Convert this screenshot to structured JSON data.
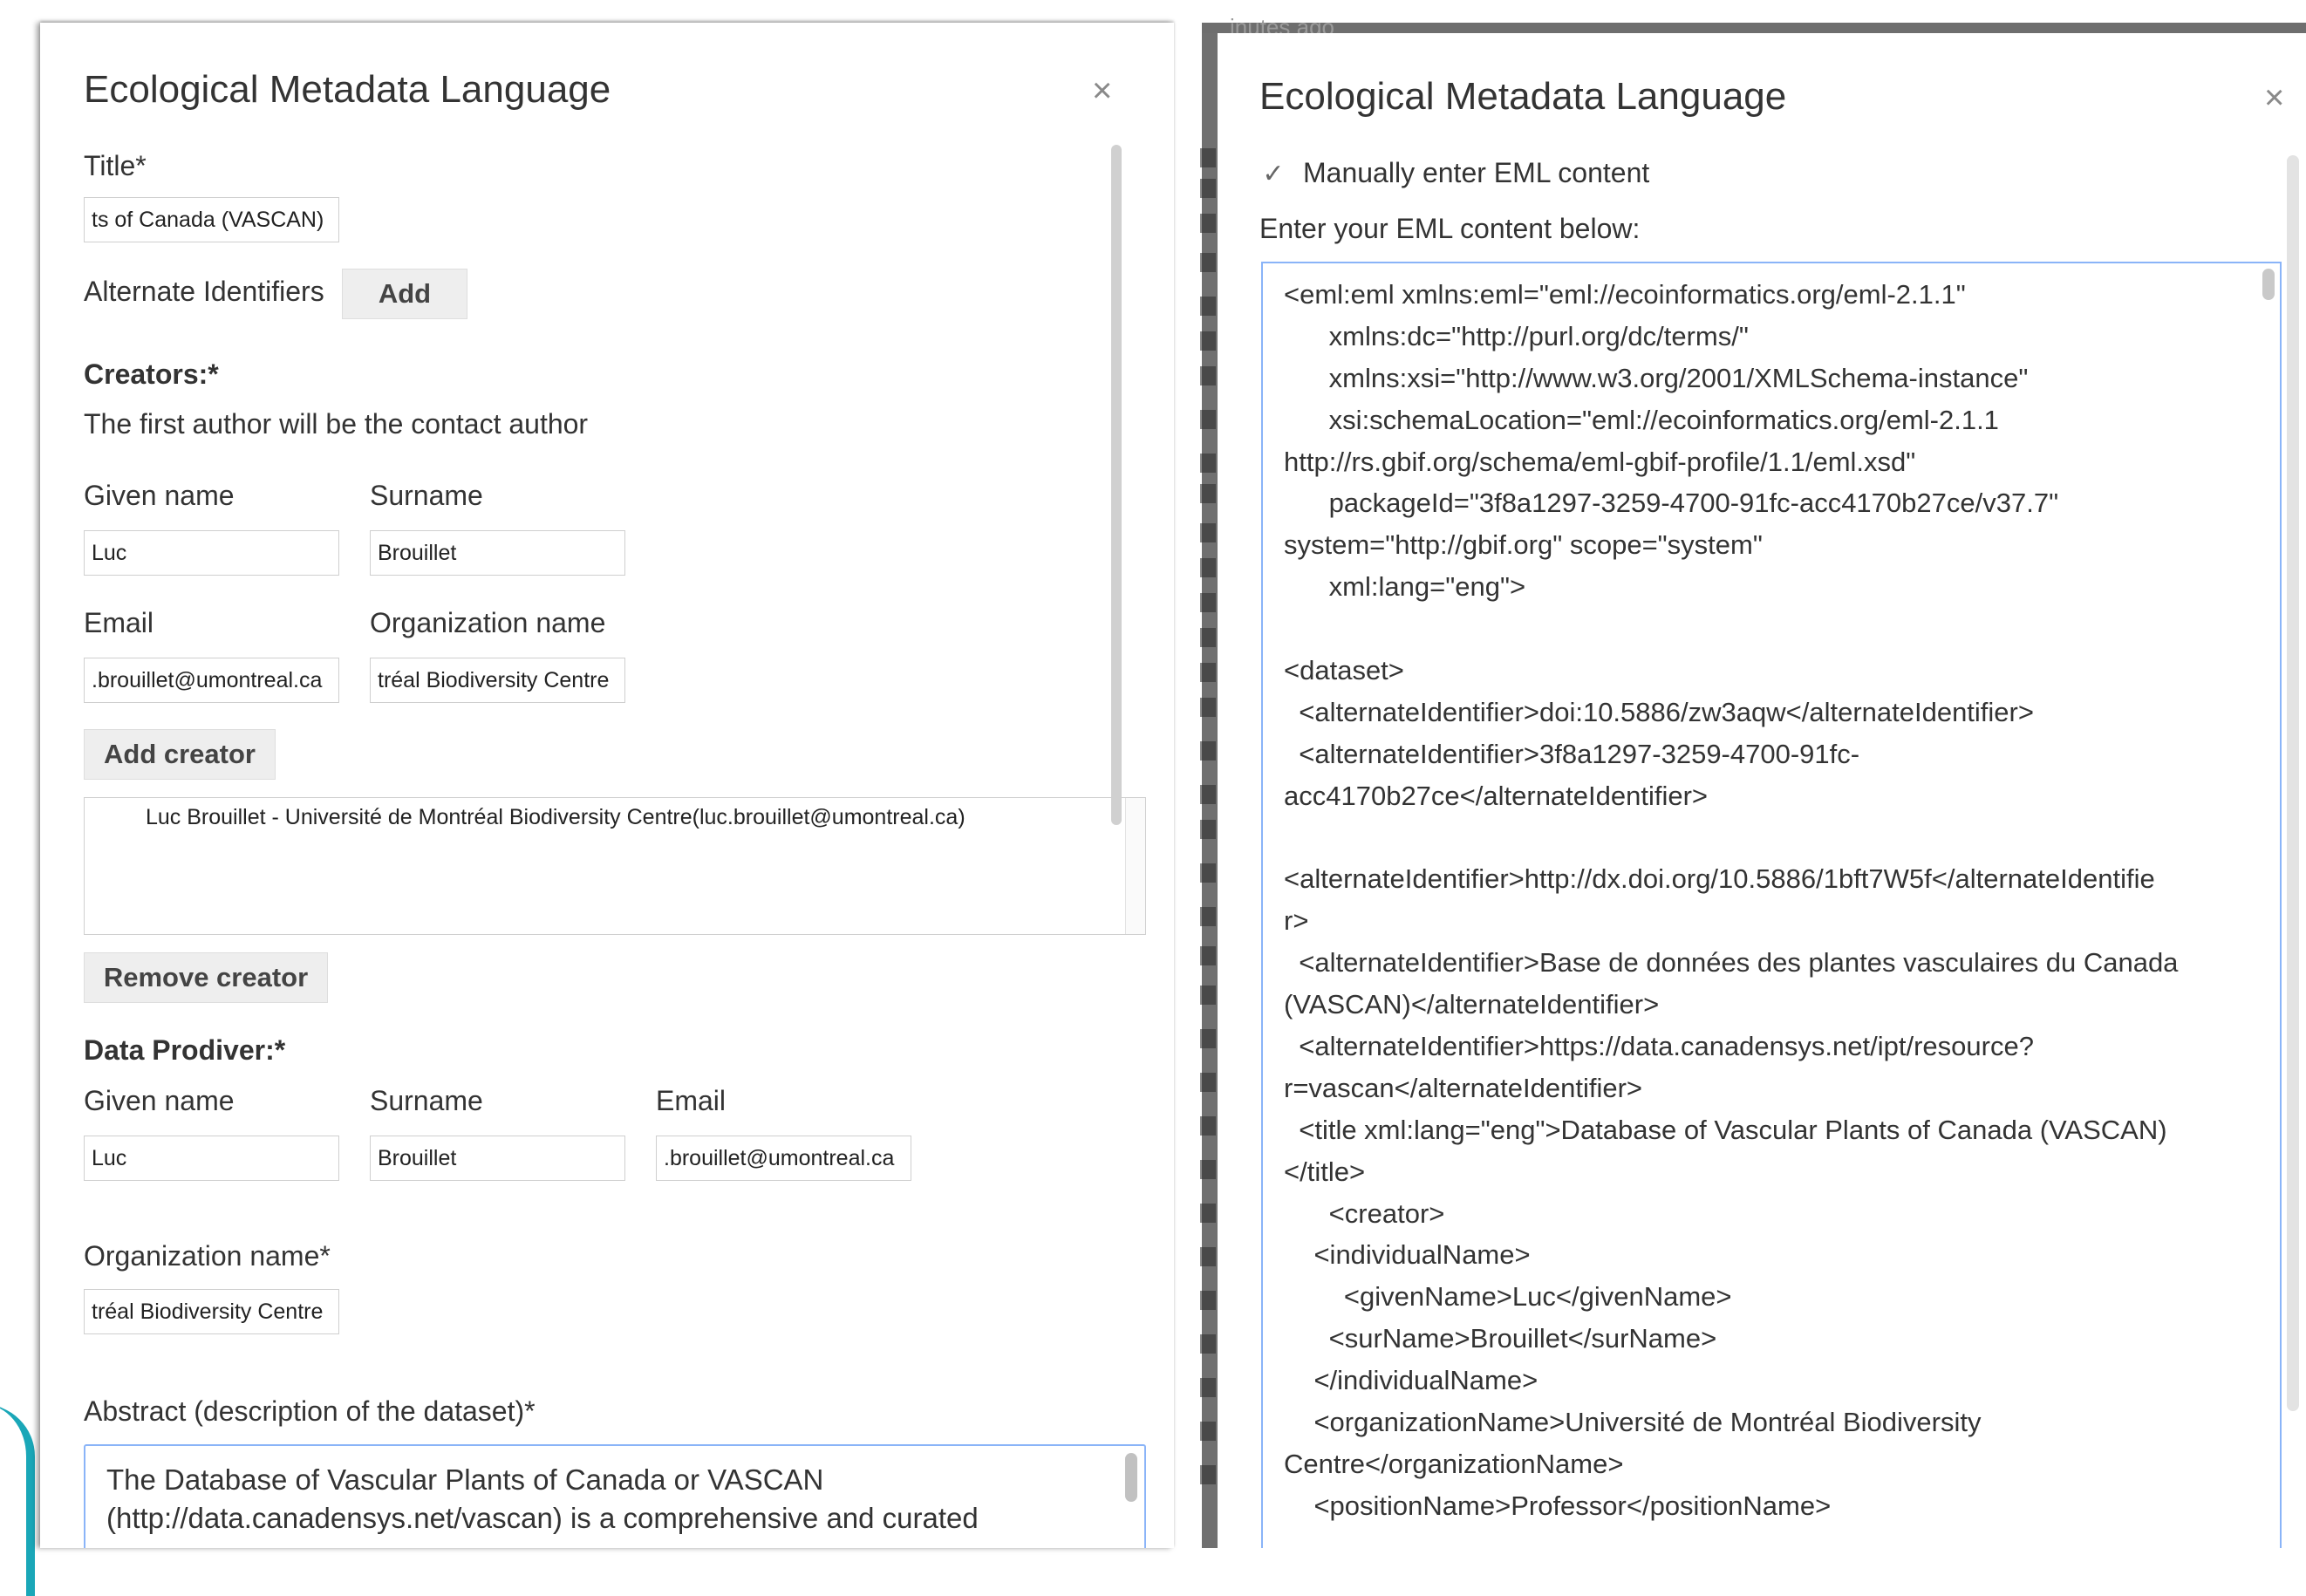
{
  "left_dialog": {
    "title": "Ecological Metadata Language",
    "close": "×",
    "title_field_label": "Title*",
    "title_value": "ts of Canada (VASCAN)",
    "alt_ids_label": "Alternate Identifiers",
    "alt_ids_add": "Add",
    "creators_label": "Creators:*",
    "creators_note": "The first author will be the contact author",
    "given_name_label": "Given name",
    "surname_label": "Surname",
    "given_name_value": "Luc",
    "surname_value": "Brouillet",
    "email_label": "Email",
    "org_label": "Organization name",
    "email_value": ".brouillet@umontreal.ca",
    "org_value": "tréal Biodiversity Centre",
    "add_creator": "Add creator",
    "creator_list": [
      "Luc Brouillet - Université de Montréal Biodiversity Centre(luc.brouillet@umontreal.ca)"
    ],
    "remove_creator": "Remove creator",
    "provider_label": "Data Prodiver:*",
    "provider_given_label": "Given name",
    "provider_surname_label": "Surname",
    "provider_email_label": "Email",
    "provider_given_value": "Luc",
    "provider_surname_value": "Brouillet",
    "provider_email_value": ".brouillet@umontreal.ca",
    "provider_org_label": "Organization name*",
    "provider_org_value": "tréal Biodiversity Centre",
    "abstract_label": "Abstract (description of the dataset)*",
    "abstract_line1": "The Database of Vascular Plants of Canada or VASCAN",
    "abstract_line2": "(http://data.canadensys.net/vascan) is a comprehensive and curated"
  },
  "background_page": {
    "top_text": "inutes ago"
  },
  "right_dialog": {
    "title": "Ecological Metadata Language",
    "close": "×",
    "manual_checkbox_label": "Manually enter EML content",
    "manual_checked": true,
    "enter_label": "Enter your EML content below:",
    "eml_lines": [
      "<eml:eml xmlns:eml=\"eml://ecoinformatics.org/eml-2.1.1\"",
      "      xmlns:dc=\"http://purl.org/dc/terms/\"",
      "      xmlns:xsi=\"http://www.w3.org/2001/XMLSchema-instance\"",
      "      xsi:schemaLocation=\"eml://ecoinformatics.org/eml-2.1.1",
      "http://rs.gbif.org/schema/eml-gbif-profile/1.1/eml.xsd\"",
      "      packageId=\"3f8a1297-3259-4700-91fc-acc4170b27ce/v37.7\"",
      "system=\"http://gbif.org\" scope=\"system\"",
      "      xml:lang=\"eng\">",
      "",
      "<dataset>",
      "  <alternateIdentifier>doi:10.5886/zw3aqw</alternateIdentifier>",
      "  <alternateIdentifier>3f8a1297-3259-4700-91fc-",
      "acc4170b27ce</alternateIdentifier>",
      "",
      "<alternateIdentifier>http://dx.doi.org/10.5886/1bft7W5f</alternateIdentifie",
      "r>",
      "  <alternateIdentifier>Base de données des plantes vasculaires du Canada",
      "(VASCAN)</alternateIdentifier>",
      "  <alternateIdentifier>https://data.canadensys.net/ipt/resource?",
      "r=vascan</alternateIdentifier>",
      "  <title xml:lang=\"eng\">Database of Vascular Plants of Canada (VASCAN)",
      "</title>",
      "      <creator>",
      "    <individualName>",
      "        <givenName>Luc</givenName>",
      "      <surName>Brouillet</surName>",
      "    </individualName>",
      "    <organizationName>Université de Montréal Biodiversity",
      "Centre</organizationName>",
      "    <positionName>Professor</positionName>"
    ]
  },
  "colors": {
    "focus_border": "#8ab4f8",
    "button_bg": "#eeeeee",
    "background_strip": "#707070",
    "accent_arc": "#1aa7b8"
  }
}
